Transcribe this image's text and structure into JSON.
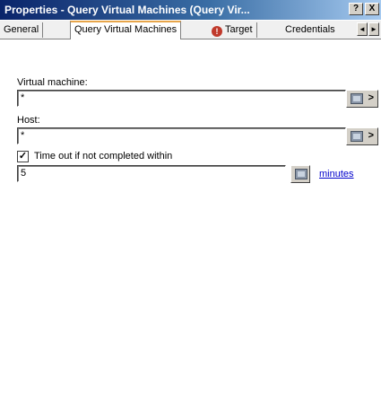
{
  "window": {
    "title": "Properties - Query Virtual Machines (Query Vir...",
    "help_label": "?",
    "close_label": "X"
  },
  "tabs": [
    {
      "label": "General"
    },
    {
      "label": "Query Virtual Machines"
    },
    {
      "label": "Target"
    },
    {
      "label": "Credentials"
    }
  ],
  "tab_scroll": {
    "left": "◄",
    "right": "►"
  },
  "form": {
    "vm_label": "Virtual machine:",
    "vm_value": "*",
    "host_label": "Host:",
    "host_value": "*",
    "timeout_checked": true,
    "timeout_check_mark": "✓",
    "timeout_label": "Time out if not completed within",
    "timeout_value": "5",
    "minutes_label": "minutes",
    "browse_arrow": ">"
  },
  "colors": {
    "title_bar": "#0a246a",
    "active_tab_accent": "#e8a64b",
    "link": "#0000cc"
  },
  "icons": {
    "warning": "warning-icon",
    "browse": "browse-icon"
  }
}
